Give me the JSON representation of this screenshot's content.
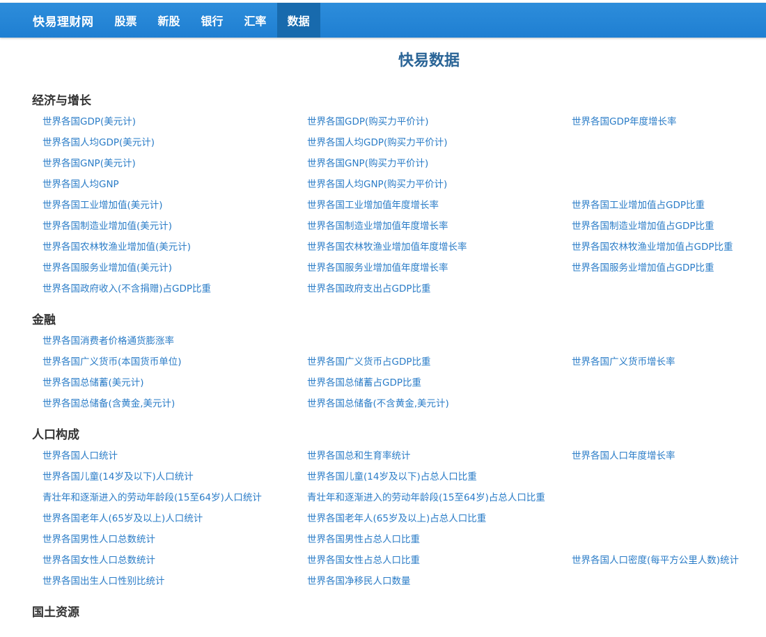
{
  "nav": {
    "brand": "快易理财网",
    "items": [
      "股票",
      "新股",
      "银行",
      "汇率",
      "数据"
    ],
    "active_index": 4
  },
  "page_title": "快易数据",
  "sections": [
    {
      "title": "经济与增长",
      "links": [
        "世界各国GDP(美元计)",
        "世界各国GDP(购买力平价计)",
        "世界各国GDP年度增长率",
        "世界各国人均GDP(美元计)",
        "世界各国人均GDP(购买力平价计)",
        "",
        "世界各国GNP(美元计)",
        "世界各国GNP(购买力平价计)",
        "",
        "世界各国人均GNP",
        "世界各国人均GNP(购买力平价计)",
        "",
        "世界各国工业增加值(美元计)",
        "世界各国工业增加值年度增长率",
        "世界各国工业增加值占GDP比重",
        "世界各国制造业增加值(美元计)",
        "世界各国制造业增加值年度增长率",
        "世界各国制造业增加值占GDP比重",
        "世界各国农林牧渔业增加值(美元计)",
        "世界各国农林牧渔业增加值年度增长率",
        "世界各国农林牧渔业增加值占GDP比重",
        "世界各国服务业增加值(美元计)",
        "世界各国服务业增加值年度增长率",
        "世界各国服务业增加值占GDP比重",
        "世界各国政府收入(不含捐赠)占GDP比重",
        "世界各国政府支出占GDP比重",
        ""
      ]
    },
    {
      "title": "金融",
      "links": [
        "世界各国消费者价格通货膨涨率",
        "",
        "",
        "世界各国广义货币(本国货币单位)",
        "世界各国广义货币占GDP比重",
        "世界各国广义货币增长率",
        "世界各国总储蓄(美元计)",
        "世界各国总储蓄占GDP比重",
        "",
        "世界各国总储备(含黄金,美元计)",
        "世界各国总储备(不含黄金,美元计)",
        ""
      ]
    },
    {
      "title": "人口构成",
      "links": [
        "世界各国人口统计",
        "世界各国总和生育率统计",
        "世界各国人口年度增长率",
        "世界各国儿童(14岁及以下)人口统计",
        "世界各国儿童(14岁及以下)占总人口比重",
        "",
        "青壮年和逐渐进入的劳动年龄段(15至64岁)人口统计",
        "青壮年和逐渐进入的劳动年龄段(15至64岁)占总人口比重",
        "",
        "世界各国老年人(65岁及以上)人口统计",
        "世界各国老年人(65岁及以上)占总人口比重",
        "",
        "世界各国男性人口总数统计",
        "世界各国男性占总人口比重",
        "",
        "世界各国女性人口总数统计",
        "世界各国女性占总人口比重",
        "世界各国人口密度(每平方公里人数)统计",
        "世界各国出生人口性别比统计",
        "世界各国净移民人口数量",
        ""
      ]
    },
    {
      "title": "国土资源",
      "links": []
    }
  ]
}
